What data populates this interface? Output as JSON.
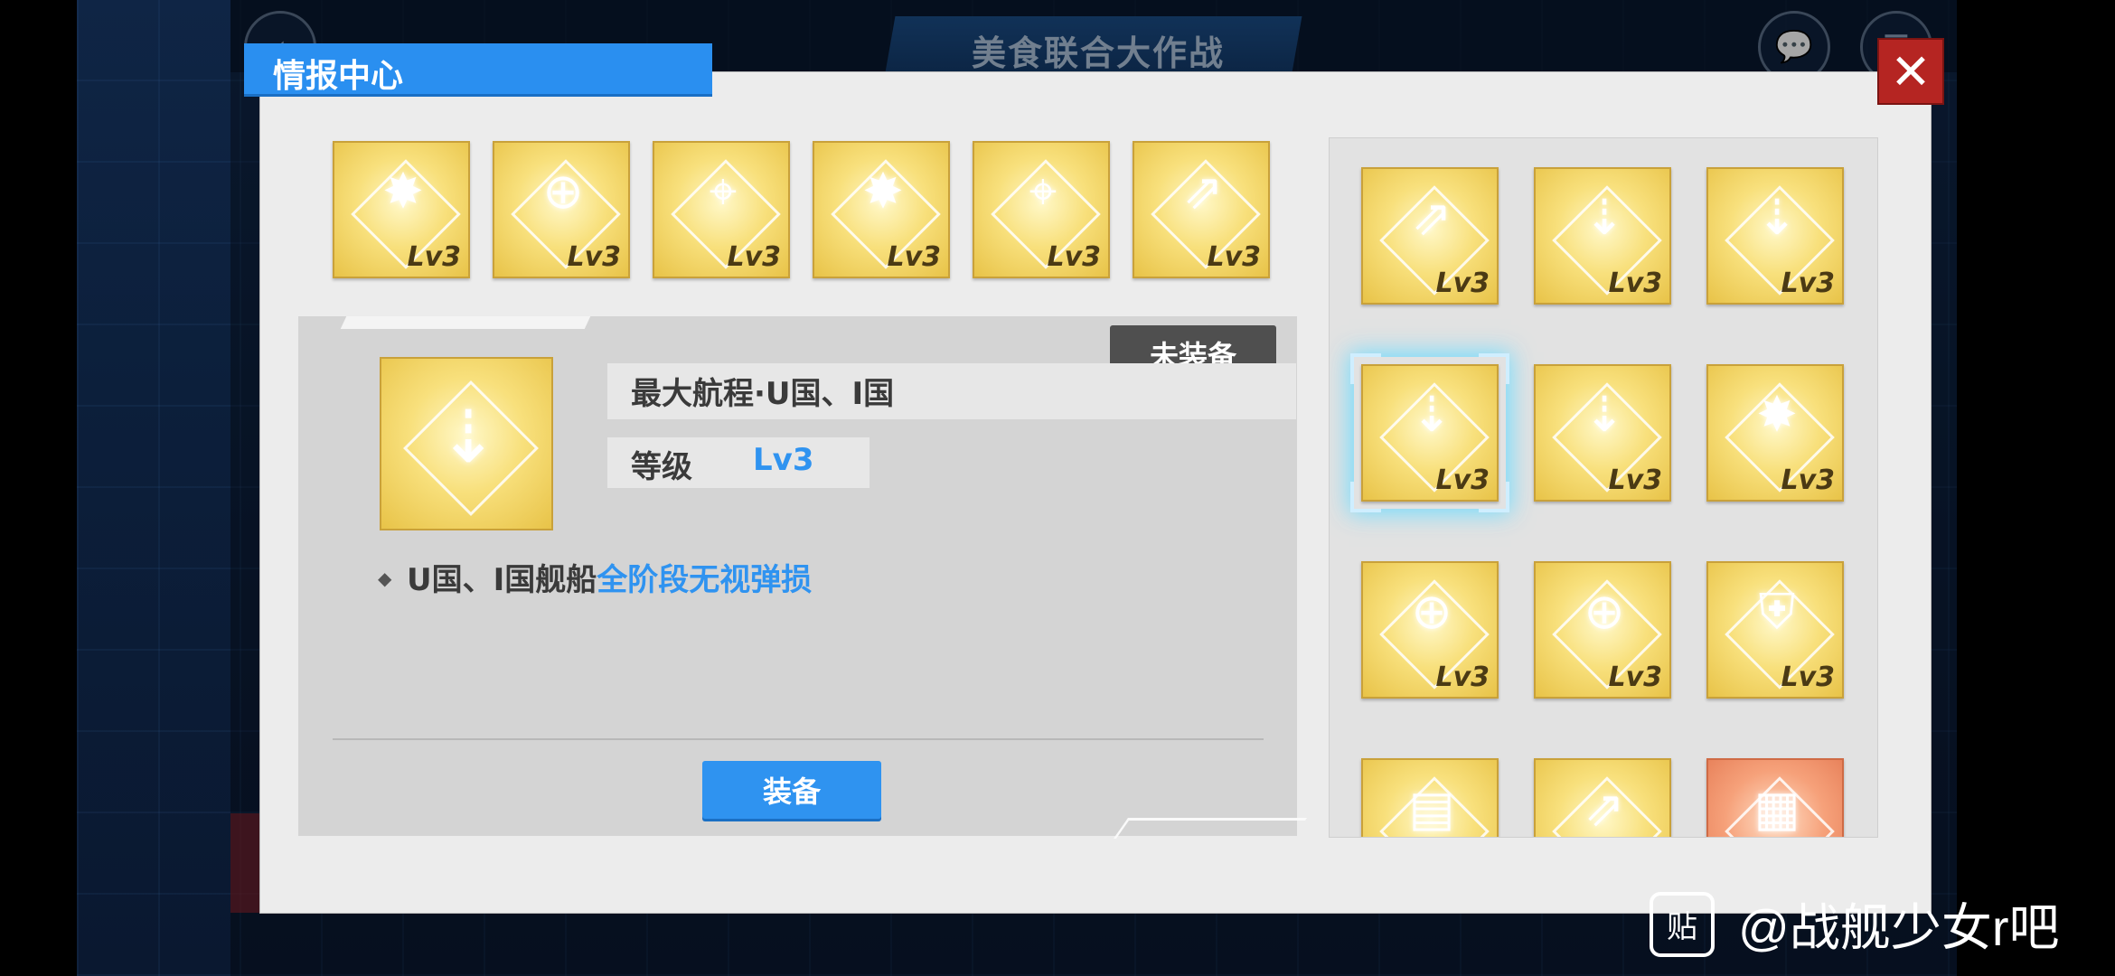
{
  "header": {
    "event_title": "美食联合大作战",
    "back_icon": "back-arrow-icon",
    "chat_icon": "chat-bubble-icon",
    "menu_icon": "menu-icon"
  },
  "modal": {
    "title": "情报中心",
    "close_label": "✕"
  },
  "equipped_slots": [
    {
      "icon": "explosion-shell-icon",
      "level": "Lv3"
    },
    {
      "icon": "ship-target-icon",
      "level": "Lv3"
    },
    {
      "icon": "crosshair-icon",
      "level": "Lv3"
    },
    {
      "icon": "explosion-shell-icon",
      "level": "Lv3"
    },
    {
      "icon": "crosshair-icon",
      "level": "Lv3"
    },
    {
      "icon": "wing-arrow-icon",
      "level": "Lv3"
    }
  ],
  "detail": {
    "status": "未装备",
    "name": "最大航程·U国、I国",
    "level_label": "等级",
    "level_value": "Lv3",
    "icon": "shells-icon",
    "desc_prefix": "U国、I国舰船",
    "desc_highlight": "全阶段无视弹损",
    "equip_button": "装备"
  },
  "inventory": [
    {
      "icon": "wing-arrow-icon",
      "level": "Lv3"
    },
    {
      "icon": "shells-icon",
      "level": "Lv3"
    },
    {
      "icon": "shells-icon",
      "level": "Lv3"
    },
    {
      "icon": "shells-icon",
      "level": "Lv3",
      "selected": true
    },
    {
      "icon": "shells-icon",
      "level": "Lv3"
    },
    {
      "icon": "explosion-shell-icon",
      "level": "Lv3"
    },
    {
      "icon": "ship-target-icon",
      "level": "Lv3"
    },
    {
      "icon": "ship-target-icon",
      "level": "Lv3"
    },
    {
      "icon": "shield-icon",
      "level": "Lv3"
    },
    {
      "icon": "document-icon",
      "level": ""
    },
    {
      "icon": "wing-arrow-icon",
      "level": ""
    },
    {
      "icon": "box-icon",
      "level": "",
      "variant": "peach"
    }
  ],
  "watermark": {
    "logo": "贴",
    "text": "@战舰少女r吧"
  }
}
